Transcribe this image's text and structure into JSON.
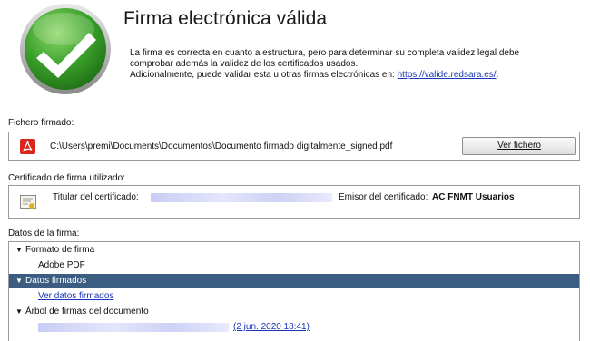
{
  "header": {
    "title": "Firma electrónica válida",
    "desc_line1": "La firma es correcta en cuanto a estructura, pero para determinar su completa validez legal debe",
    "desc_line2": "comprobar además la validez de los certificados usados.",
    "desc_line3_prefix": "Adicionalmente, puede validar esta u otras firmas electrónicas en: ",
    "desc_link": "https://valide.redsara.es/",
    "desc_line3_suffix": ".",
    "status_icon": "check-icon",
    "status_color": "#2e8b1e"
  },
  "file_section": {
    "label": "Fichero firmado:",
    "file_icon": "pdf-icon",
    "path": "C:\\Users\\premi\\Documents\\Documentos\\Documento firmado digitalmente_signed.pdf",
    "button_label": "Ver fichero"
  },
  "cert_section": {
    "label": "Certificado de firma utilizado:",
    "icon": "certificate-icon",
    "subject_label": "Titular del certificado:",
    "issuer_label": "Emisor del certificado:",
    "issuer_value": "AC FNMT Usuarios"
  },
  "signature_data": {
    "label": "Datos de la firma:",
    "items": [
      {
        "label": "Formato de firma",
        "expanded": true
      },
      {
        "label": "Adobe PDF"
      },
      {
        "label": "Datos firmados",
        "expanded": true,
        "selected": true
      },
      {
        "label": "Ver datos firmados"
      },
      {
        "label": "Árbol de firmas del documento",
        "expanded": true
      },
      {
        "label": "(2 jun. 2020 18:41)"
      }
    ]
  },
  "colors": {
    "selection": "#3b5d81",
    "link": "#1a35b8"
  }
}
